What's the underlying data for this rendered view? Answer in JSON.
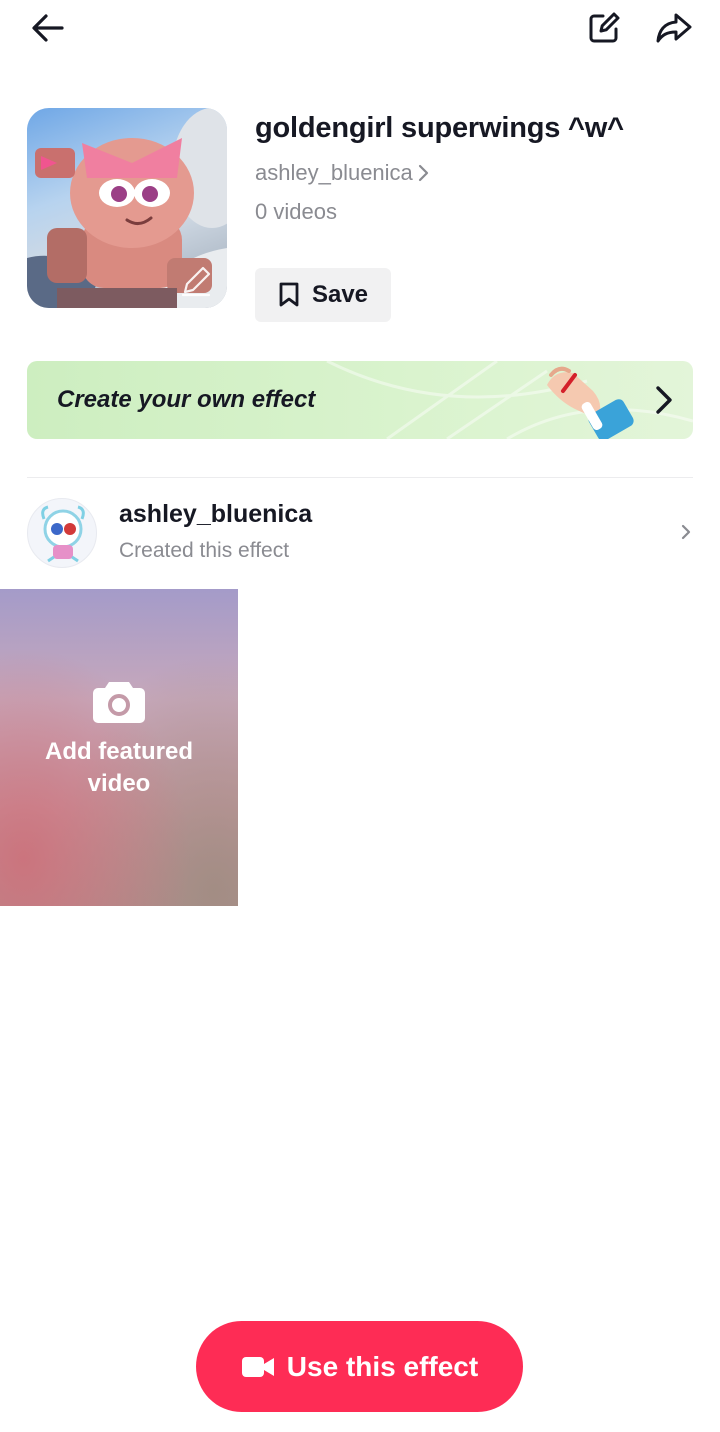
{
  "topbar": {
    "back_icon": "arrow-left-icon",
    "edit_icon": "edit-square-icon",
    "share_icon": "share-arrow-icon"
  },
  "effect": {
    "title": "goldengirl superwings ^w^",
    "creator": "ashley_bluenica",
    "video_count": "0 videos",
    "save_label": "Save"
  },
  "banner": {
    "text": "Create your own effect"
  },
  "creator_row": {
    "name": "ashley_bluenica",
    "subtitle": "Created this effect"
  },
  "featured": {
    "label": "Add featured video",
    "icon": "camera-icon"
  },
  "cta": {
    "label": "Use this effect",
    "icon": "video-camera-icon",
    "color": "#fe2c55"
  }
}
